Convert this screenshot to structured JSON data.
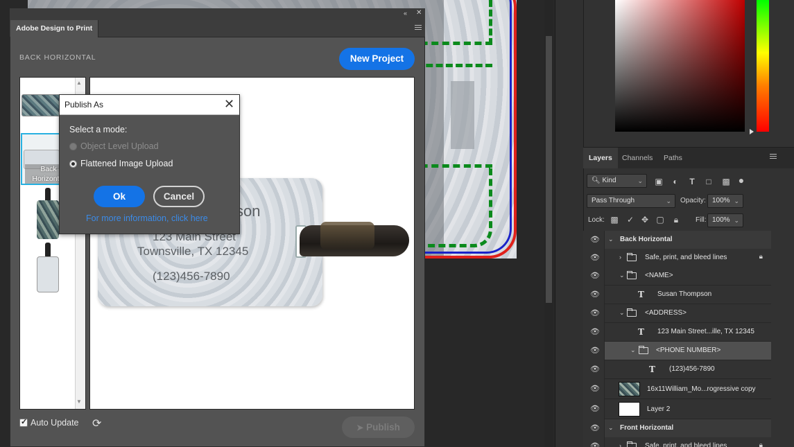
{
  "panel": {
    "tab_title": "Adobe Design to Print",
    "section_title": "BACK HORIZONTAL",
    "new_project_label": "New Project",
    "auto_update_label": "Auto Update",
    "auto_update_checked": true,
    "publish_label": "Publish",
    "thumbnail_label": "Back Horizontal"
  },
  "preview": {
    "name_partial": "son",
    "street": "123 Main Street",
    "city": "Townsville, TX 12345",
    "phone": "(123)456-7890"
  },
  "dialog": {
    "title": "Publish As",
    "mode_heading": "Select a mode:",
    "options": [
      {
        "label": "Object Level Upload",
        "enabled": false,
        "selected": false
      },
      {
        "label": "Flattened Image Upload",
        "enabled": true,
        "selected": true
      }
    ],
    "ok_label": "Ok",
    "cancel_label": "Cancel",
    "more_info_link": "For more information, click here"
  },
  "layers_panel": {
    "tabs": [
      "Layers",
      "Channels",
      "Paths"
    ],
    "active_tab": "Layers",
    "filter_kind": "Kind",
    "blend_mode": "Pass Through",
    "opacity_label": "Opacity:",
    "opacity_value": "100%",
    "lock_label": "Lock:",
    "fill_label": "Fill:",
    "fill_value": "100%",
    "layers": [
      {
        "name": "Back Horizontal",
        "type": "group",
        "expanded": true,
        "indent": 0
      },
      {
        "name": "Safe, print, and bleed lines",
        "type": "group",
        "expanded": false,
        "indent": 1,
        "locked": true
      },
      {
        "name": "<NAME>",
        "type": "group",
        "expanded": true,
        "indent": 1
      },
      {
        "name": "Susan Thompson",
        "type": "text",
        "indent": 2
      },
      {
        "name": "<ADDRESS>",
        "type": "group",
        "expanded": true,
        "indent": 1
      },
      {
        "name": "123 Main Street...ille, TX 12345",
        "type": "text",
        "indent": 2
      },
      {
        "name": "<PHONE NUMBER>",
        "type": "group",
        "expanded": true,
        "indent": 2,
        "selected": true
      },
      {
        "name": "(123)456-7890",
        "type": "text",
        "indent": 3
      },
      {
        "name": "16x11William_Mo...rogressive copy",
        "type": "image",
        "indent": 1
      },
      {
        "name": "Layer 2",
        "type": "image",
        "indent": 1
      },
      {
        "name": "Front Horizontal",
        "type": "group",
        "expanded": true,
        "indent": 0
      },
      {
        "name": "Safe, print, and bleed lines",
        "type": "group",
        "expanded": false,
        "indent": 1,
        "locked": true
      }
    ]
  },
  "colors": {
    "accent_blue": "#1473e6",
    "panel_bg": "#535353",
    "app_bg": "#282828"
  }
}
